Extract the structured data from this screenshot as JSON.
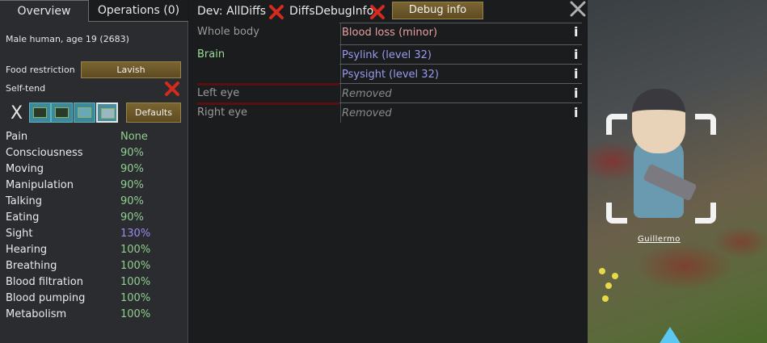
{
  "tabs": {
    "overview": "Overview",
    "operations": "Operations (0)"
  },
  "pawn": {
    "description": "Male human, age 19 (2683)",
    "name": "Guillermo"
  },
  "food": {
    "label": "Food restriction",
    "value": "Lavish"
  },
  "selftend": {
    "label": "Self-tend"
  },
  "medicine": {
    "none_label": "X",
    "defaults_label": "Defaults"
  },
  "capacities": [
    {
      "name": "Pain",
      "value": "None"
    },
    {
      "name": "Consciousness",
      "value": "90%"
    },
    {
      "name": "Moving",
      "value": "90%"
    },
    {
      "name": "Manipulation",
      "value": "90%"
    },
    {
      "name": "Talking",
      "value": "90%"
    },
    {
      "name": "Eating",
      "value": "90%"
    },
    {
      "name": "Sight",
      "value": "130%"
    },
    {
      "name": "Hearing",
      "value": "100%"
    },
    {
      "name": "Breathing",
      "value": "100%"
    },
    {
      "name": "Blood filtration",
      "value": "100%"
    },
    {
      "name": "Blood pumping",
      "value": "100%"
    },
    {
      "name": "Metabolism",
      "value": "100%"
    }
  ],
  "toolbar": {
    "dev_alldiffs": "Dev: AllDiffs",
    "diffs_debug": "DiffsDebugInfo",
    "debug_info": "Debug info"
  },
  "health": [
    {
      "part": "Whole body",
      "hediff": "Blood loss (minor)",
      "info": "i"
    },
    {
      "part": "Brain",
      "hediff": "Psylink (level 32)",
      "info": "i"
    },
    {
      "part": "",
      "hediff": "Psysight (level 32)",
      "info": "i"
    },
    {
      "part": "Left eye",
      "hediff": "Removed",
      "info": "i"
    },
    {
      "part": "Right eye",
      "hediff": "Removed",
      "info": "i"
    }
  ],
  "colors": {
    "blood_loss": "#e8a0a0",
    "psy": "#9a9af0",
    "removed": "#8a8a8a",
    "part_normal": "#e0e0e0",
    "part_brain": "#9adc9a",
    "part_injured": "#9a9a9a",
    "capacity_normal": "#8fd08f",
    "capacity_enhanced": "#9a8bf0",
    "close_red": "#d62a1e"
  }
}
